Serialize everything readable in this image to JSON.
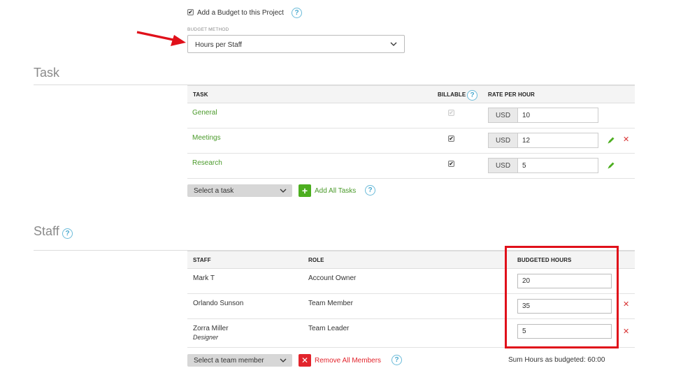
{
  "budget": {
    "checkbox_label": "Add a Budget to this Project",
    "method_label": "BUDGET METHOD",
    "method_value": "Hours per Staff"
  },
  "task_section": {
    "title": "Task",
    "headers": {
      "task": "TASK",
      "billable": "BILLABLE",
      "rate": "RATE PER HOUR"
    },
    "rows": [
      {
        "name": "General",
        "currency": "USD",
        "rate": "10"
      },
      {
        "name": "Meetings",
        "currency": "USD",
        "rate": "12"
      },
      {
        "name": "Research",
        "currency": "USD",
        "rate": "5"
      }
    ],
    "select_placeholder": "Select a task",
    "add_all_label": "Add All Tasks"
  },
  "staff_section": {
    "title": "Staff",
    "headers": {
      "staff": "STAFF",
      "role": "ROLE",
      "hours": "BUDGETED HOURS"
    },
    "rows": [
      {
        "name": "Mark T",
        "subtitle": "",
        "role": "Account Owner",
        "hours": "20"
      },
      {
        "name": "Orlando Sunson",
        "subtitle": "",
        "role": "Team Member",
        "hours": "35"
      },
      {
        "name": "Zorra Miller",
        "subtitle": "Designer",
        "role": "Team Leader",
        "hours": "5"
      }
    ],
    "select_placeholder": "Select a team member",
    "remove_all_label": "Remove All Members",
    "sum_label": "Sum Hours as budgeted: 60:00"
  },
  "help_icon_glyph": "?",
  "colors": {
    "link_green": "#4a9a2a",
    "add_green": "#4cae1f",
    "remove_red": "#e2242c",
    "highlight_red": "#e0101a",
    "help_blue": "#4aa9cf"
  },
  "icons": [
    "check-icon",
    "chevron-down-icon",
    "help-icon",
    "pencil-icon",
    "close-icon",
    "plus-icon",
    "arrow-annotation"
  ]
}
